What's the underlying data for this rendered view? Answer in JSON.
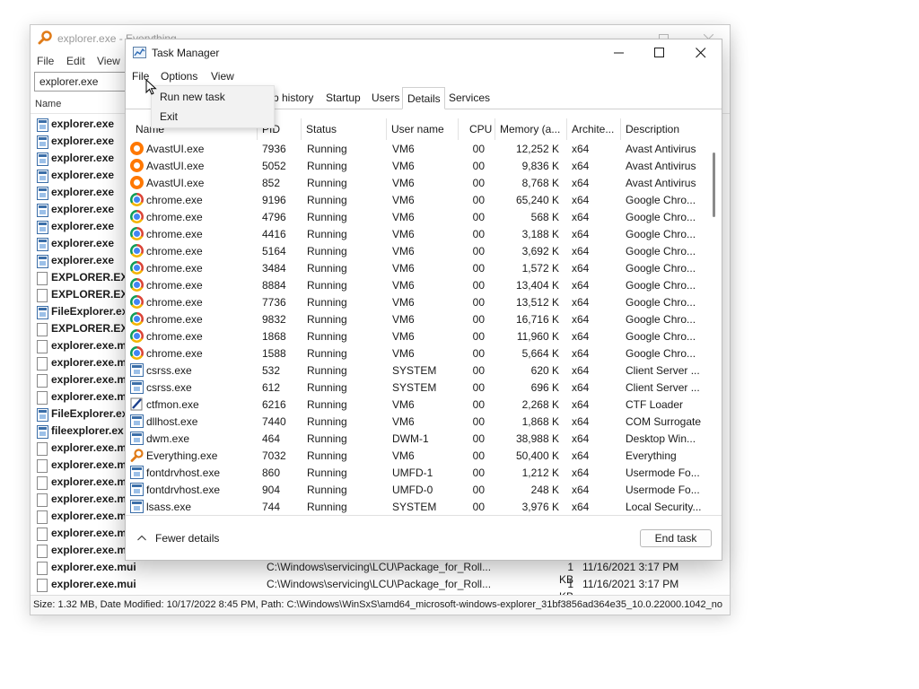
{
  "everything": {
    "title": "explorer.exe - Everything",
    "menu": [
      "File",
      "Edit",
      "View"
    ],
    "search_value": "explorer.exe",
    "column_name": "Name",
    "rows": [
      {
        "name": "explorer.exe",
        "icon": "app-icon",
        "bold": true
      },
      {
        "name": "explorer.exe",
        "icon": "app-icon",
        "bold": true
      },
      {
        "name": "explorer.exe",
        "icon": "app-icon",
        "bold": true
      },
      {
        "name": "explorer.exe",
        "icon": "app-icon",
        "bold": true
      },
      {
        "name": "explorer.exe",
        "icon": "app-icon",
        "bold": true
      },
      {
        "name": "explorer.exe",
        "icon": "app-icon",
        "bold": true
      },
      {
        "name": "explorer.exe",
        "icon": "app-icon",
        "bold": true
      },
      {
        "name": "explorer.exe",
        "icon": "app-icon",
        "bold": true
      },
      {
        "name": "explorer.exe",
        "icon": "app-icon",
        "bold": true
      },
      {
        "name": "EXPLORER.EXE-",
        "icon": "document-icon",
        "bold": true
      },
      {
        "name": "EXPLORER.EXE-",
        "icon": "document-icon",
        "bold": true
      },
      {
        "name": "FileExplorer.ex",
        "icon": "app-icon",
        "bold": true
      },
      {
        "name": "EXPLORER.EXE-",
        "icon": "document-icon",
        "bold": true
      },
      {
        "name": "explorer.exe.m",
        "icon": "document-icon",
        "bold": true
      },
      {
        "name": "explorer.exe.m",
        "icon": "document-icon",
        "bold": true
      },
      {
        "name": "explorer.exe.m",
        "icon": "document-icon",
        "bold": true
      },
      {
        "name": "explorer.exe.m",
        "icon": "document-icon",
        "bold": true
      },
      {
        "name": "FileExplorer.ex",
        "icon": "app-icon",
        "bold": true
      },
      {
        "name": "fileexplorer.ex",
        "icon": "app-icon",
        "bold": true
      },
      {
        "name": "explorer.exe.m",
        "icon": "document-icon",
        "bold": true
      },
      {
        "name": "explorer.exe.m",
        "icon": "document-icon",
        "bold": true
      },
      {
        "name": "explorer.exe.m",
        "icon": "document-icon",
        "bold": true
      },
      {
        "name": "explorer.exe.m",
        "icon": "document-icon",
        "bold": true
      },
      {
        "name": "explorer.exe.m",
        "icon": "document-icon",
        "bold": true
      },
      {
        "name": "explorer.exe.m",
        "icon": "document-icon",
        "bold": true
      },
      {
        "name": "explorer.exe.m",
        "icon": "document-icon",
        "bold": true
      },
      {
        "name": "explorer.exe.mui",
        "icon": "document-icon",
        "bold": true,
        "path": "C:\\Windows\\servicing\\LCU\\Package_for_Roll...",
        "size": "1 KB",
        "date": "11/16/2021 3:17 PM"
      },
      {
        "name": "explorer.exe.mui",
        "icon": "document-icon",
        "bold": true,
        "path": "C:\\Windows\\servicing\\LCU\\Package_for_Roll...",
        "size": "1 KB",
        "date": "11/16/2021 3:17 PM"
      }
    ],
    "status": "Size: 1.32 MB, Date Modified: 10/17/2022 8:45 PM, Path: C:\\Windows\\WinSxS\\amd64_microsoft-windows-explorer_31bf3856ad364e35_10.0.22000.1042_no"
  },
  "taskmanager": {
    "title": "Task Manager",
    "menu": [
      "File",
      "Options",
      "View"
    ],
    "file_menu": [
      "Run new task",
      "Exit"
    ],
    "tabs": [
      "p history",
      "Startup",
      "Users",
      "Details",
      "Services"
    ],
    "active_tab": "Details",
    "columns": [
      "Name",
      "PID",
      "Status",
      "User name",
      "CPU",
      "Memory (a...",
      "Archite...",
      "Description"
    ],
    "rows": [
      {
        "name": "AvastUI.exe",
        "icon": "avast-icon",
        "pid": "7936",
        "status": "Running",
        "user": "VM6",
        "cpu": "00",
        "mem": "12,252 K",
        "arch": "x64",
        "desc": "Avast Antivirus"
      },
      {
        "name": "AvastUI.exe",
        "icon": "avast-icon",
        "pid": "5052",
        "status": "Running",
        "user": "VM6",
        "cpu": "00",
        "mem": "9,836 K",
        "arch": "x64",
        "desc": "Avast Antivirus"
      },
      {
        "name": "AvastUI.exe",
        "icon": "avast-icon",
        "pid": "852",
        "status": "Running",
        "user": "VM6",
        "cpu": "00",
        "mem": "8,768 K",
        "arch": "x64",
        "desc": "Avast Antivirus"
      },
      {
        "name": "chrome.exe",
        "icon": "chrome-icon",
        "pid": "9196",
        "status": "Running",
        "user": "VM6",
        "cpu": "00",
        "mem": "65,240 K",
        "arch": "x64",
        "desc": "Google Chro..."
      },
      {
        "name": "chrome.exe",
        "icon": "chrome-icon",
        "pid": "4796",
        "status": "Running",
        "user": "VM6",
        "cpu": "00",
        "mem": "568 K",
        "arch": "x64",
        "desc": "Google Chro..."
      },
      {
        "name": "chrome.exe",
        "icon": "chrome-icon",
        "pid": "4416",
        "status": "Running",
        "user": "VM6",
        "cpu": "00",
        "mem": "3,188 K",
        "arch": "x64",
        "desc": "Google Chro..."
      },
      {
        "name": "chrome.exe",
        "icon": "chrome-icon",
        "pid": "5164",
        "status": "Running",
        "user": "VM6",
        "cpu": "00",
        "mem": "3,692 K",
        "arch": "x64",
        "desc": "Google Chro..."
      },
      {
        "name": "chrome.exe",
        "icon": "chrome-icon",
        "pid": "3484",
        "status": "Running",
        "user": "VM6",
        "cpu": "00",
        "mem": "1,572 K",
        "arch": "x64",
        "desc": "Google Chro..."
      },
      {
        "name": "chrome.exe",
        "icon": "chrome-icon",
        "pid": "8884",
        "status": "Running",
        "user": "VM6",
        "cpu": "00",
        "mem": "13,404 K",
        "arch": "x64",
        "desc": "Google Chro..."
      },
      {
        "name": "chrome.exe",
        "icon": "chrome-icon",
        "pid": "7736",
        "status": "Running",
        "user": "VM6",
        "cpu": "00",
        "mem": "13,512 K",
        "arch": "x64",
        "desc": "Google Chro..."
      },
      {
        "name": "chrome.exe",
        "icon": "chrome-icon",
        "pid": "9832",
        "status": "Running",
        "user": "VM6",
        "cpu": "00",
        "mem": "16,716 K",
        "arch": "x64",
        "desc": "Google Chro..."
      },
      {
        "name": "chrome.exe",
        "icon": "chrome-icon",
        "pid": "1868",
        "status": "Running",
        "user": "VM6",
        "cpu": "00",
        "mem": "11,960 K",
        "arch": "x64",
        "desc": "Google Chro..."
      },
      {
        "name": "chrome.exe",
        "icon": "chrome-icon",
        "pid": "1588",
        "status": "Running",
        "user": "VM6",
        "cpu": "00",
        "mem": "5,664 K",
        "arch": "x64",
        "desc": "Google Chro..."
      },
      {
        "name": "csrss.exe",
        "icon": "app-icon",
        "pid": "532",
        "status": "Running",
        "user": "SYSTEM",
        "cpu": "00",
        "mem": "620 K",
        "arch": "x64",
        "desc": "Client Server ..."
      },
      {
        "name": "csrss.exe",
        "icon": "app-icon",
        "pid": "612",
        "status": "Running",
        "user": "SYSTEM",
        "cpu": "00",
        "mem": "696 K",
        "arch": "x64",
        "desc": "Client Server ..."
      },
      {
        "name": "ctfmon.exe",
        "icon": "pen-icon",
        "pid": "6216",
        "status": "Running",
        "user": "VM6",
        "cpu": "00",
        "mem": "2,268 K",
        "arch": "x64",
        "desc": "CTF Loader"
      },
      {
        "name": "dllhost.exe",
        "icon": "app-icon",
        "pid": "7440",
        "status": "Running",
        "user": "VM6",
        "cpu": "00",
        "mem": "1,868 K",
        "arch": "x64",
        "desc": "COM Surrogate"
      },
      {
        "name": "dwm.exe",
        "icon": "app-icon",
        "pid": "464",
        "status": "Running",
        "user": "DWM-1",
        "cpu": "00",
        "mem": "38,988 K",
        "arch": "x64",
        "desc": "Desktop Win..."
      },
      {
        "name": "Everything.exe",
        "icon": "magnifier-icon",
        "pid": "7032",
        "status": "Running",
        "user": "VM6",
        "cpu": "00",
        "mem": "50,400 K",
        "arch": "x64",
        "desc": "Everything"
      },
      {
        "name": "fontdrvhost.exe",
        "icon": "app-icon",
        "pid": "860",
        "status": "Running",
        "user": "UMFD-1",
        "cpu": "00",
        "mem": "1,212 K",
        "arch": "x64",
        "desc": "Usermode Fo..."
      },
      {
        "name": "fontdrvhost.exe",
        "icon": "app-icon",
        "pid": "904",
        "status": "Running",
        "user": "UMFD-0",
        "cpu": "00",
        "mem": "248 K",
        "arch": "x64",
        "desc": "Usermode Fo..."
      },
      {
        "name": "lsass.exe",
        "icon": "app-icon",
        "pid": "744",
        "status": "Running",
        "user": "SYSTEM",
        "cpu": "00",
        "mem": "3,976 K",
        "arch": "x64",
        "desc": "Local Security..."
      }
    ],
    "fewer_details": "Fewer details",
    "end_task": "End task"
  }
}
